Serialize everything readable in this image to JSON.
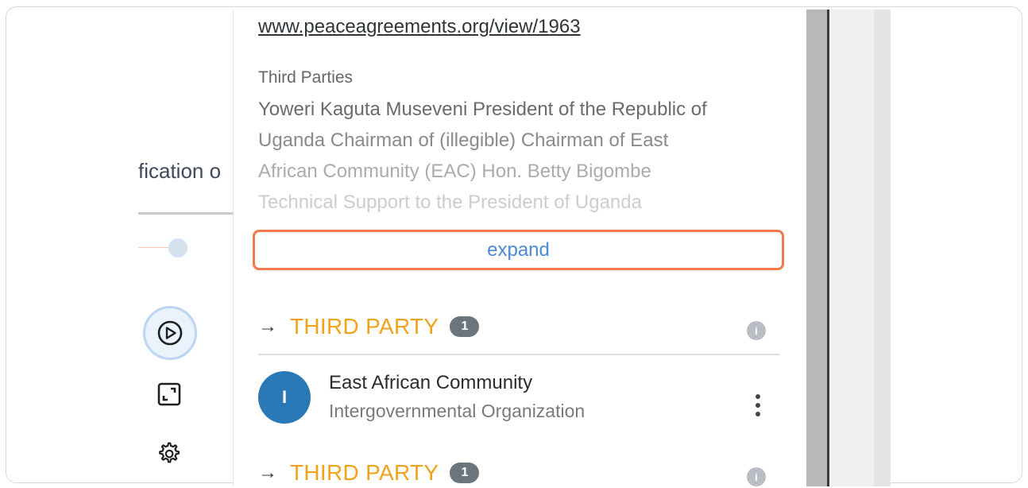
{
  "background": {
    "cut_label": "fication o"
  },
  "panel": {
    "url": "www.peaceagreements.org/view/1963",
    "third_parties_heading": "Third Parties",
    "third_parties_lines": [
      "Yoweri Kaguta Museveni President of the Republic of",
      "Uganda Chairman of (illegible) Chairman of East",
      "African Community (EAC) Hon. Betty Bigombe",
      "Technical Support to the President of Uganda"
    ],
    "expand_label": "expand",
    "sections": [
      {
        "arrow": "→",
        "title": "THIRD PARTY",
        "count": "1",
        "info": "i"
      },
      {
        "arrow": "→",
        "title": "THIRD PARTY",
        "count": "1",
        "info": "i"
      }
    ],
    "entity": {
      "avatar_letter": "I",
      "name": "East African Community",
      "type": "Intergovernmental Organization"
    }
  },
  "colors": {
    "accent_orange": "#f0a21b",
    "focus_border": "#f07a4a",
    "link_blue": "#4a8ad4",
    "avatar_blue": "#2a79b6",
    "badge_gray": "#6c757d"
  },
  "icons": {
    "play": "play-circle-icon",
    "fullscreen": "fullscreen-icon",
    "settings": "gear-icon",
    "info": "info-icon",
    "more": "more-vertical-icon"
  }
}
